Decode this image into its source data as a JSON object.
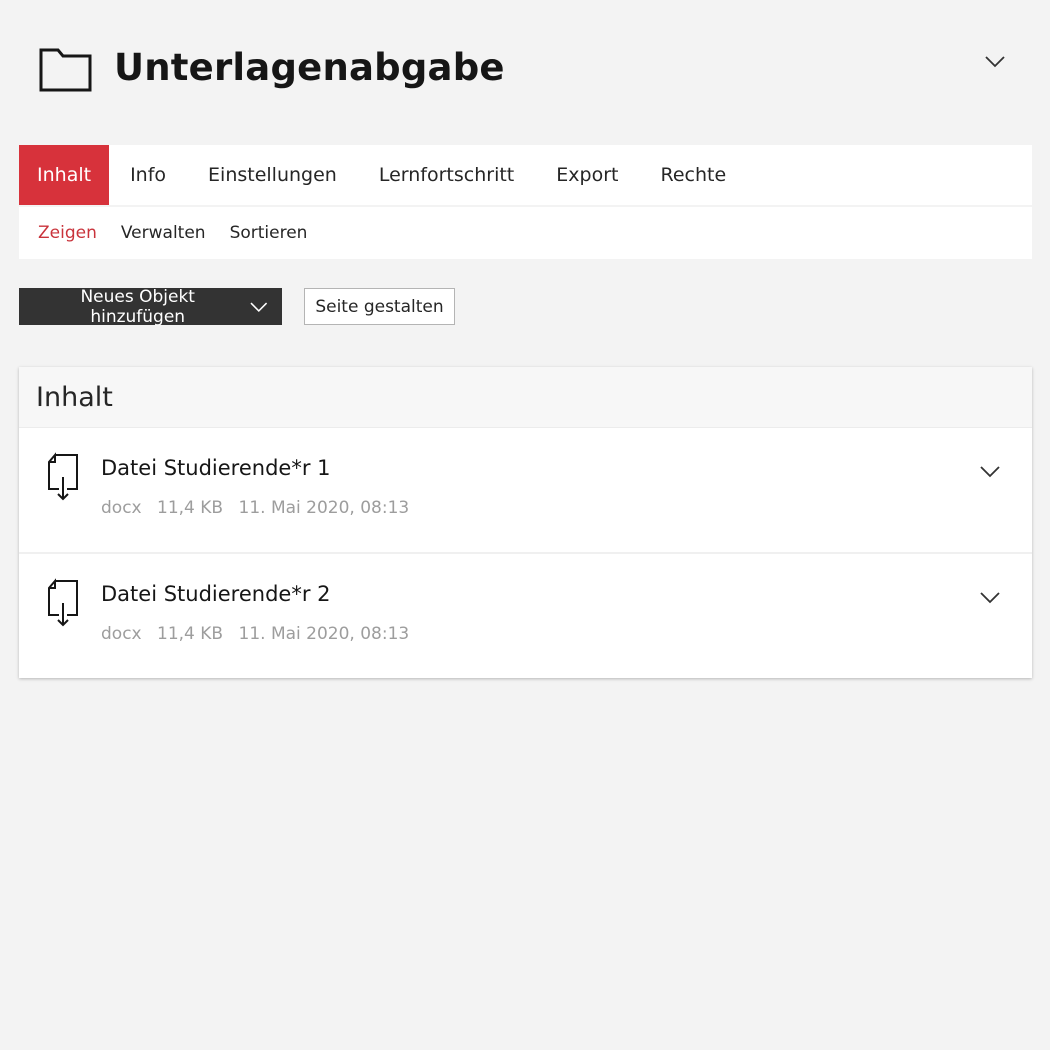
{
  "header": {
    "title": "Unterlagenabgabe",
    "icon": "folder-icon",
    "actions_icon": "chevron-down-icon"
  },
  "tabs": [
    {
      "label": "Inhalt",
      "active": true
    },
    {
      "label": "Info",
      "active": false
    },
    {
      "label": "Einstellungen",
      "active": false
    },
    {
      "label": "Lernfortschritt",
      "active": false
    },
    {
      "label": "Export",
      "active": false
    },
    {
      "label": "Rechte",
      "active": false
    }
  ],
  "subtabs": [
    {
      "label": "Zeigen",
      "active": true
    },
    {
      "label": "Verwalten",
      "active": false
    },
    {
      "label": "Sortieren",
      "active": false
    }
  ],
  "toolbar": {
    "add_object_label": "Neues Objekt hinzufügen",
    "design_page_label": "Seite gestalten"
  },
  "content": {
    "title": "Inhalt",
    "items": [
      {
        "title": "Datei Studierende*r 1",
        "type": "docx",
        "size": "11,4 KB",
        "date": "11. Mai 2020, 08:13",
        "icon": "file-download-icon"
      },
      {
        "title": "Datei Studierende*r 2",
        "type": "docx",
        "size": "11,4 KB",
        "date": "11. Mai 2020, 08:13",
        "icon": "file-download-icon"
      }
    ]
  },
  "colors": {
    "accent": "#d7323b",
    "dark_button": "#333333",
    "background": "#f3f3f3",
    "muted_text": "#9d9d9d"
  }
}
